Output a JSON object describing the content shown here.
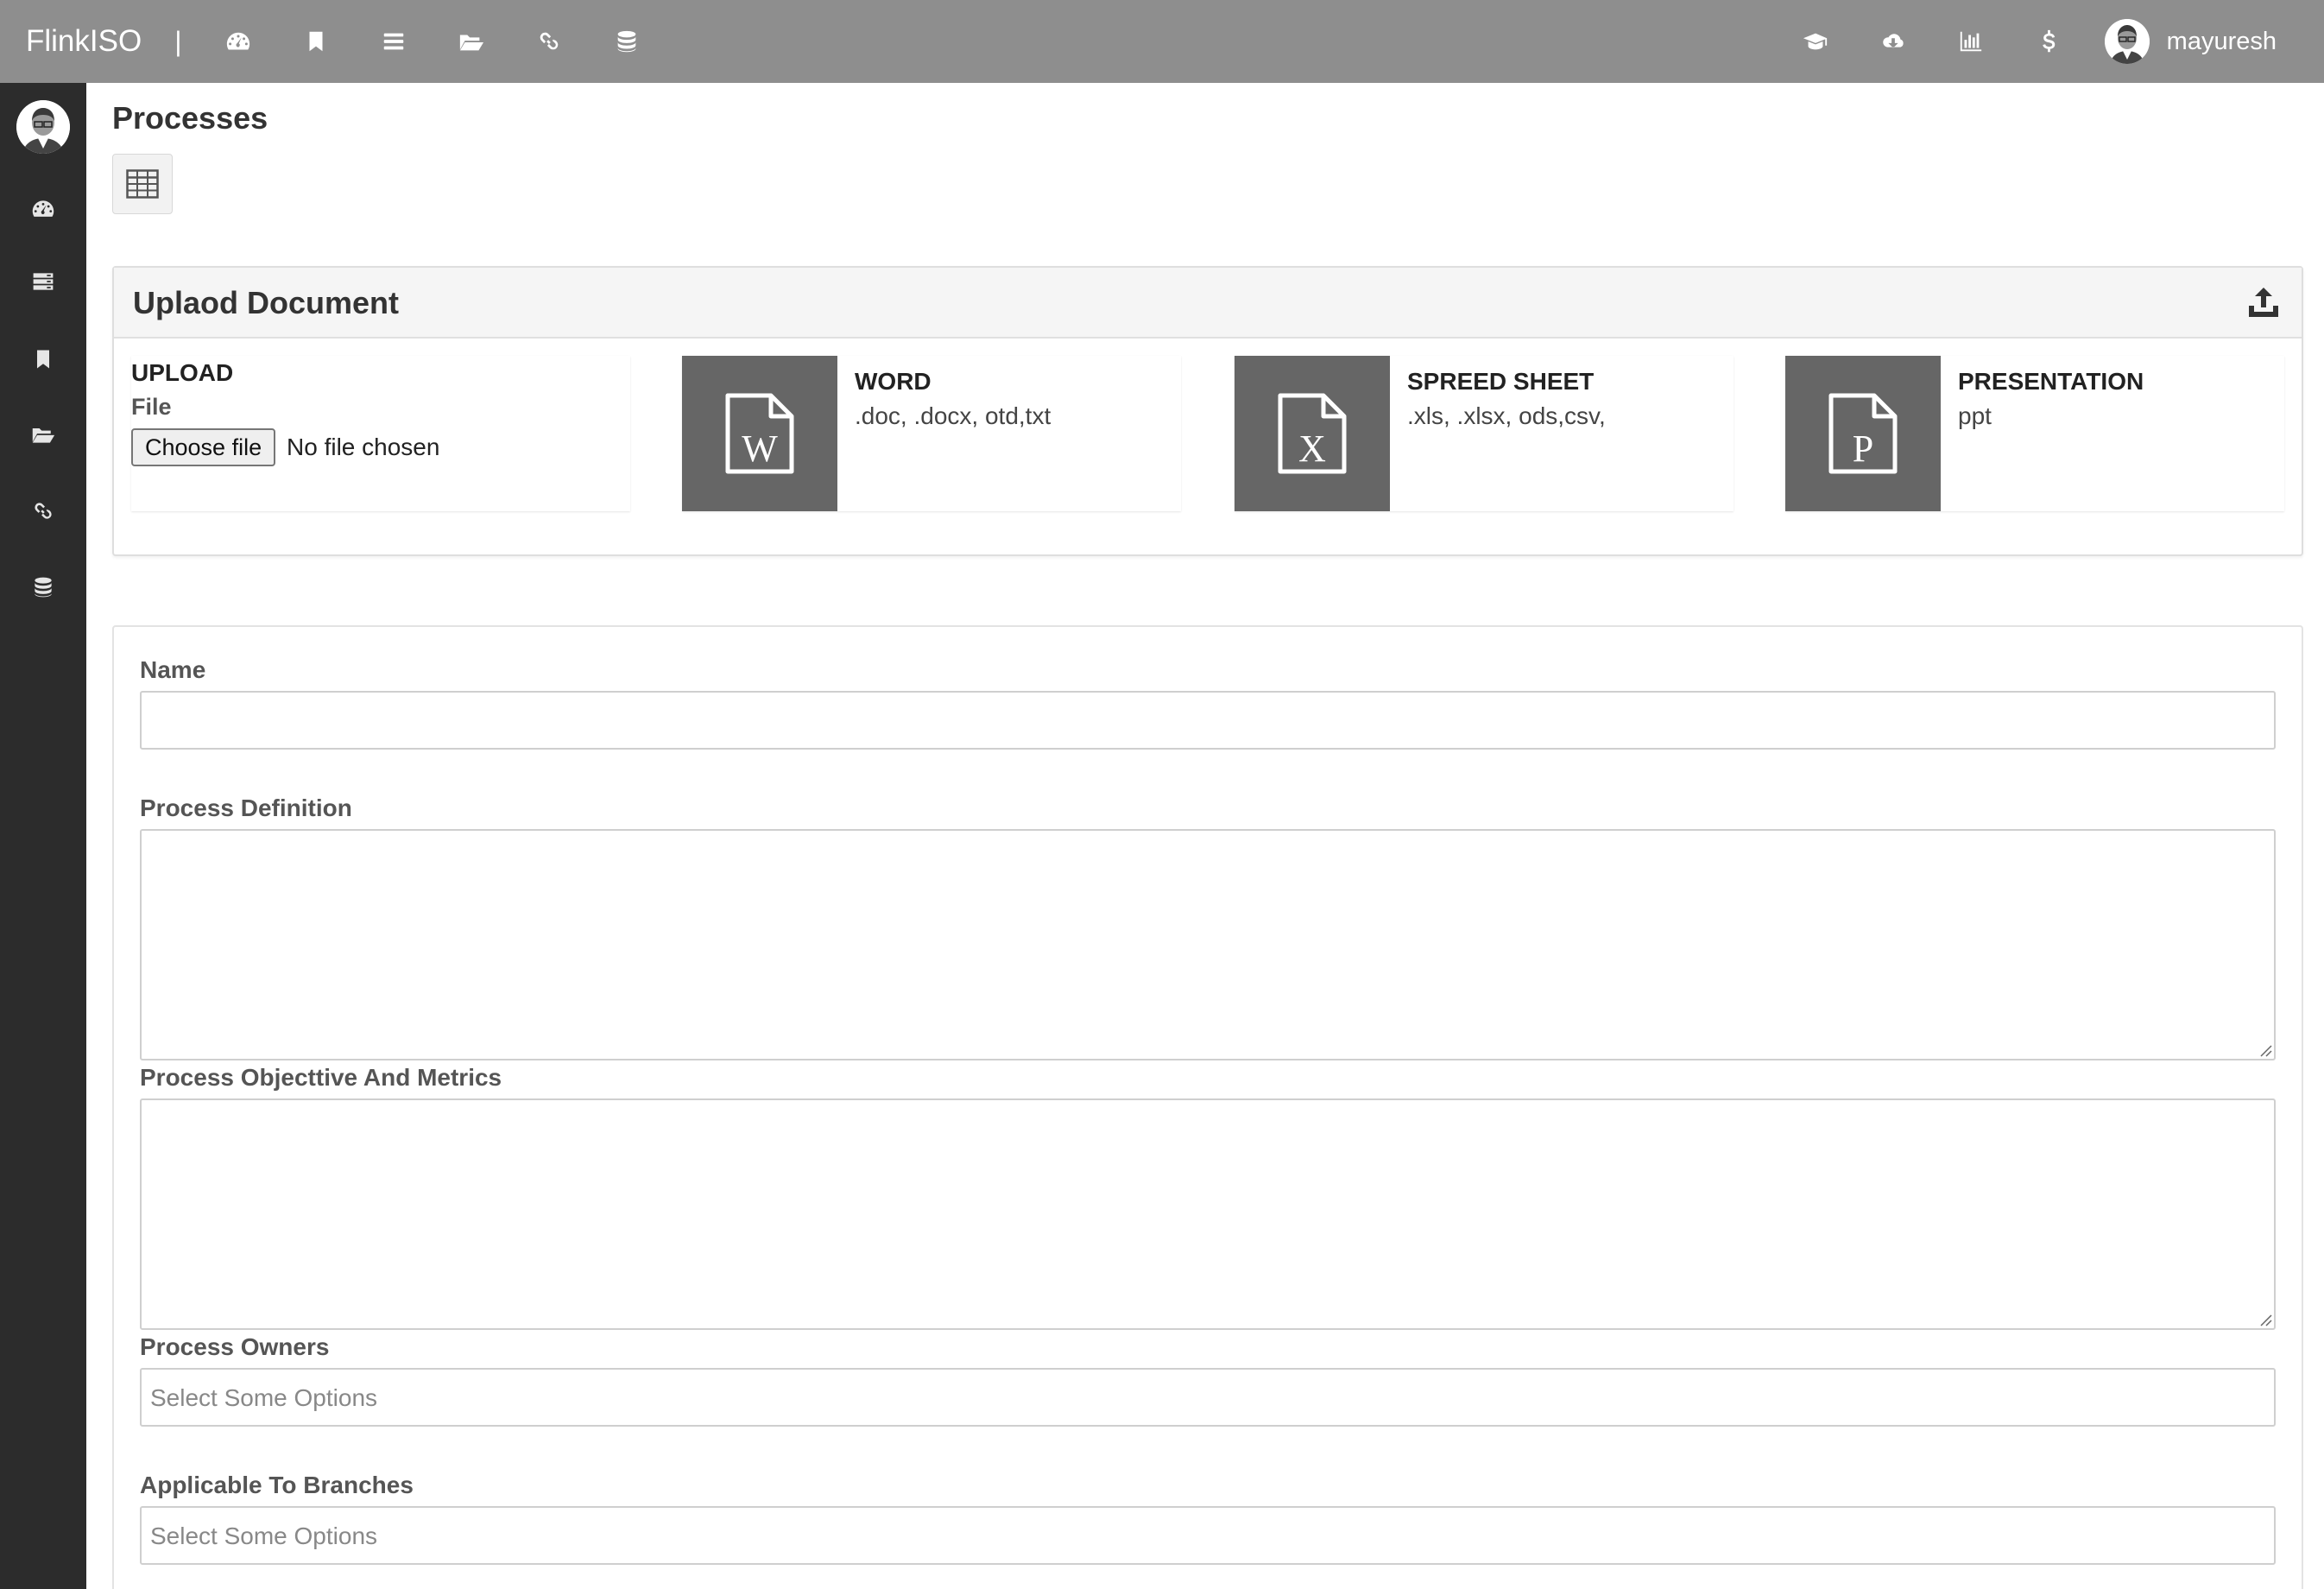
{
  "app": {
    "brand": "FlinkISO",
    "separator": "|"
  },
  "topnav": {
    "left_icons": [
      "dashboard-icon",
      "bookmark-icon",
      "list-icon",
      "folder-open-icon",
      "link-icon",
      "database-icon"
    ],
    "right_icons": [
      "graduation-cap-icon",
      "cloud-download-icon",
      "bar-chart-icon",
      "dollar-icon"
    ],
    "username": "mayuresh"
  },
  "sidebar": {
    "icons": [
      "dashboard-icon",
      "tasks-icon",
      "bookmark-icon",
      "folder-open-icon",
      "link-icon",
      "database-icon"
    ]
  },
  "page": {
    "title": "Processes",
    "view_toggle_icon": "table-grid-icon"
  },
  "upload_panel": {
    "title": "Uplaod Document",
    "header_icon": "upload-icon",
    "upload": {
      "title": "UPLOAD",
      "file_label": "File",
      "button": "Choose file",
      "status": "No file chosen"
    },
    "types": [
      {
        "title": "WORD",
        "extensions": ".doc, .docx, otd,txt",
        "letter": "W"
      },
      {
        "title": "SPREED SHEET",
        "extensions": ".xls, .xlsx, ods,csv,",
        "letter": "X"
      },
      {
        "title": "PRESENTATION",
        "extensions": "ppt",
        "letter": "P"
      }
    ]
  },
  "form": {
    "name_label": "Name",
    "name_value": "",
    "definition_label": "Process Definition",
    "definition_value": "",
    "objective_label": "Process Objecttive And Metrics",
    "objective_value": "",
    "owners_label": "Process Owners",
    "owners_placeholder": "Select Some Options",
    "branches_label": "Applicable To Branches",
    "branches_placeholder": "Select Some Options"
  },
  "colors": {
    "topbar": "#8e8e8e",
    "sidebar": "#2c2c2c",
    "doc_tile": "#666666"
  }
}
